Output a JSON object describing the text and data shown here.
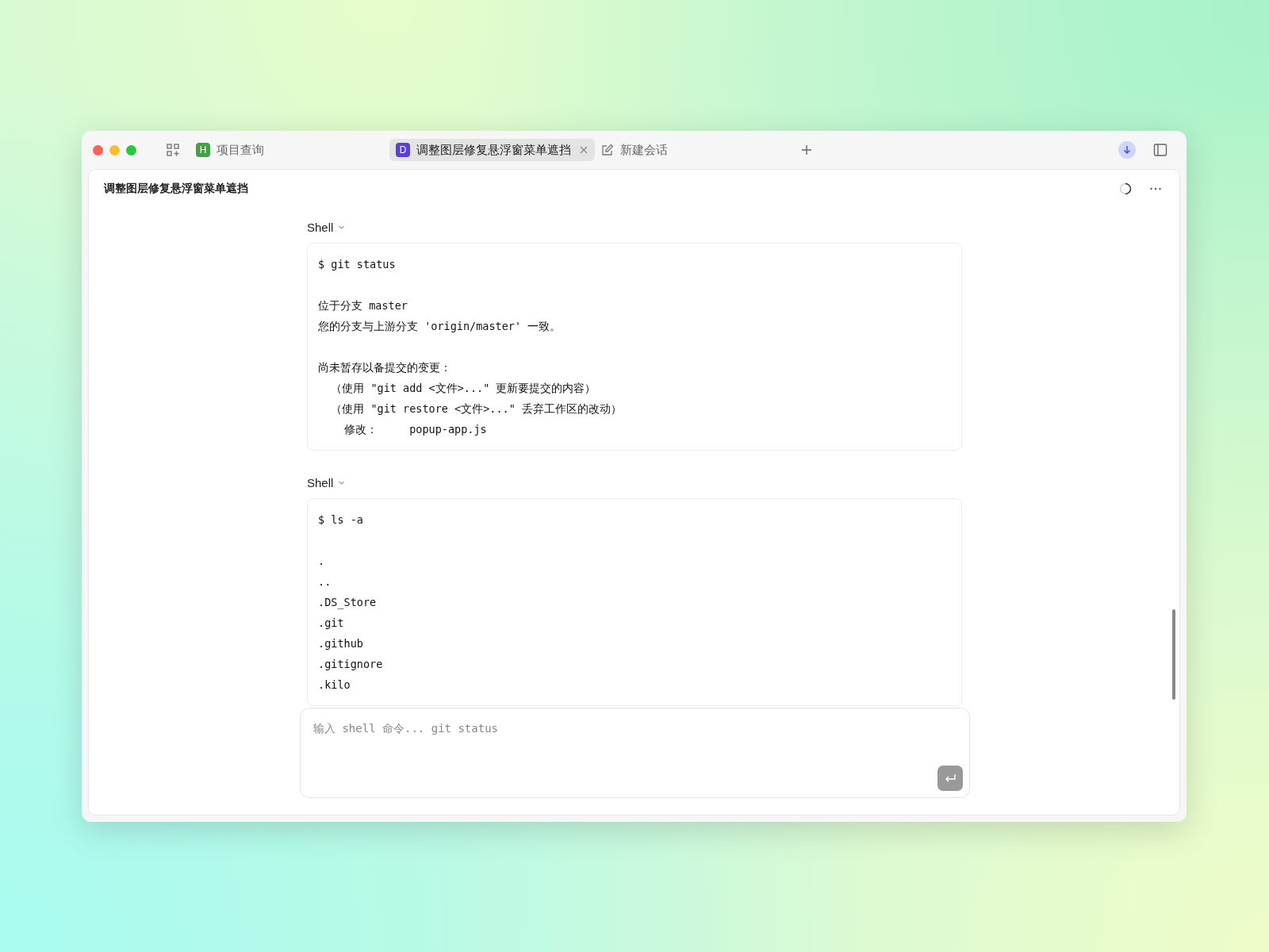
{
  "tabs": [
    {
      "kind": "project",
      "badge": "H",
      "color": "#43a047",
      "label": "项目查询",
      "selected": false
    },
    {
      "kind": "project",
      "badge": "D",
      "color": "#5b3fd8",
      "label": "调整图层修复悬浮窗菜单遮挡",
      "selected": true
    },
    {
      "kind": "new",
      "label": "新建会话",
      "selected": false
    }
  ],
  "header": {
    "title": "调整图层修复悬浮窗菜单遮挡"
  },
  "blocks": [
    {
      "label": "Shell",
      "groups": [
        [
          "$ git status"
        ],
        [
          "位于分支 master",
          "您的分支与上游分支 'origin/master' 一致。"
        ],
        [
          "尚未暂存以备提交的变更：",
          "  （使用 \"git add <文件>...\" 更新要提交的内容）",
          "  （使用 \"git restore <文件>...\" 丢弃工作区的改动）",
          "    修改：     popup-app.js"
        ]
      ]
    },
    {
      "label": "Shell",
      "groups": [
        [
          "$ ls -a"
        ],
        [
          ".",
          "..",
          ".DS_Store",
          ".git",
          ".github",
          ".gitignore",
          ".kilo"
        ]
      ]
    }
  ],
  "input": {
    "placeholder": "输入 shell 命令... git status"
  }
}
